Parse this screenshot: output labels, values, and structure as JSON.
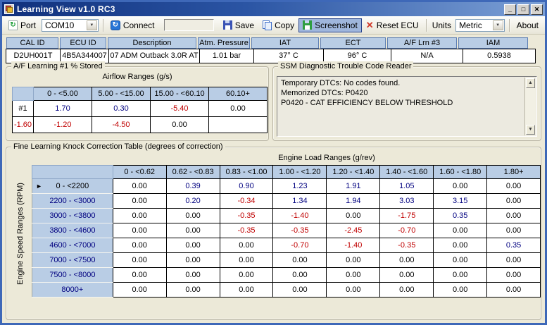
{
  "window": {
    "title": "Learning View v1.0 RC3"
  },
  "icons": {
    "minimize": "_",
    "maximize": "□",
    "close": "✕",
    "dropdown": "▼",
    "refresh": "↻",
    "reset_x": "✕",
    "row_selector": "►",
    "scroll_up": "▲",
    "scroll_down": "▼"
  },
  "toolbar": {
    "port_label": "Port",
    "port_value": "COM10",
    "connect_label": "Connect",
    "status_field_value": "",
    "save_label": "Save",
    "copy_label": "Copy",
    "screenshot_label": "Screenshot",
    "reset_label": "Reset ECU",
    "units_label": "Units",
    "units_value": "Metric",
    "about_label": "About"
  },
  "info_bar": {
    "columns": [
      {
        "label": "CAL ID",
        "value": "D2UH001T"
      },
      {
        "label": "ECU ID",
        "value": "4B5A344007"
      },
      {
        "label": "Description",
        "value": "07 ADM Outback 3.0R AT"
      },
      {
        "label": "Atm. Pressure",
        "value": "1.01 bar"
      },
      {
        "label": "IAT",
        "value": "37° C"
      },
      {
        "label": "ECT",
        "value": "96° C"
      },
      {
        "label": "A/F Lrn #3",
        "value": "N/A"
      },
      {
        "label": "IAM",
        "value": "0.5938"
      }
    ]
  },
  "af_learning": {
    "title": "A/F Learning #1 % Stored",
    "axis_label": "Airflow Ranges (g/s)",
    "col_headers": [
      "0 - <5.00",
      "5.00 - <15.00",
      "15.00 - <60.10",
      "60.10+"
    ],
    "rows": [
      {
        "label": "#1",
        "values": [
          "1.70",
          "0.30",
          "-5.40",
          "0.00"
        ]
      },
      {
        "label": "-1.60",
        "values": [
          "-1.20",
          "-4.50",
          "0.00",
          ""
        ]
      }
    ]
  },
  "dtc_reader": {
    "title": "SSM Diagnostic Trouble Code Reader",
    "lines": [
      "Temporary DTCs: No codes found.",
      "Memorized DTCs: P0420",
      "P0420 - CAT EFFICIENCY BELOW THRESHOLD"
    ]
  },
  "knock_table": {
    "title": "Fine Learning Knock Correction Table (degrees of correction)",
    "x_axis_label": "Engine Load Ranges (g/rev)",
    "y_axis_label": "Engine Speed Ranges (RPM)",
    "col_headers": [
      "0 - <0.62",
      "0.62 - <0.83",
      "0.83 - <1.00",
      "1.00 - <1.20",
      "1.20 - <1.40",
      "1.40 - <1.60",
      "1.60 - <1.80",
      "1.80+"
    ],
    "rows": [
      {
        "label": "0 - <2200",
        "selected": true,
        "values": [
          "0.00",
          "0.39",
          "0.90",
          "1.23",
          "1.91",
          "1.05",
          "0.00",
          "0.00"
        ]
      },
      {
        "label": "2200 - <3000",
        "values": [
          "0.00",
          "0.20",
          "-0.34",
          "1.34",
          "1.94",
          "3.03",
          "3.15",
          "0.00"
        ]
      },
      {
        "label": "3000 - <3800",
        "values": [
          "0.00",
          "0.00",
          "-0.35",
          "-1.40",
          "0.00",
          "-1.75",
          "0.35",
          "0.00"
        ]
      },
      {
        "label": "3800 - <4600",
        "values": [
          "0.00",
          "0.00",
          "-0.35",
          "-0.35",
          "-2.45",
          "-0.70",
          "0.00",
          "0.00"
        ]
      },
      {
        "label": "4600 - <7000",
        "values": [
          "0.00",
          "0.00",
          "0.00",
          "-0.70",
          "-1.40",
          "-0.35",
          "0.00",
          "0.35"
        ]
      },
      {
        "label": "7000 - <7500",
        "values": [
          "0.00",
          "0.00",
          "0.00",
          "0.00",
          "0.00",
          "0.00",
          "0.00",
          "0.00"
        ]
      },
      {
        "label": "7500 - <8000",
        "values": [
          "0.00",
          "0.00",
          "0.00",
          "0.00",
          "0.00",
          "0.00",
          "0.00",
          "0.00"
        ]
      },
      {
        "label": "8000+",
        "values": [
          "0.00",
          "0.00",
          "0.00",
          "0.00",
          "0.00",
          "0.00",
          "0.00",
          "0.00"
        ]
      }
    ]
  },
  "colors": {
    "header_blue": "#B9CDE5",
    "positive_value": "#000080",
    "negative_value": "#C00000",
    "highlighted_button": "#9FB6DC",
    "titlebar_dark": "#10307C",
    "client_background": "#ECE9D8"
  }
}
